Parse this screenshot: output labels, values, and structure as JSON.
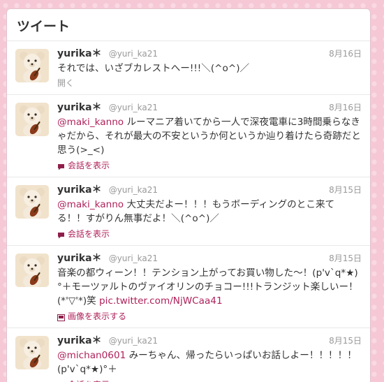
{
  "header": {
    "title": "ツイート"
  },
  "tweets": [
    {
      "name": "yurika＊",
      "handle": "@yuri_ka21",
      "date": "8月16日",
      "mention": "",
      "text": "それでは、いざブカレストへー!!!＼(^o^)／",
      "link": "",
      "action": "開く",
      "action_type": "open"
    },
    {
      "name": "yurika＊",
      "handle": "@yuri_ka21",
      "date": "8月16日",
      "mention": "@maki_kanno",
      "text": " ルーマニア着いてから一人で深夜電車に3時間乗らなきゃだから、それが最大の不安というか何というか辿り着けたら奇跡だと思う(>_<)",
      "link": "",
      "action": "会話を表示",
      "action_type": "conversation"
    },
    {
      "name": "yurika＊",
      "handle": "@yuri_ka21",
      "date": "8月15日",
      "mention": "@maki_kanno",
      "text": " 大丈夫だよー！！！もうボーディングのとこ来てる！！すがりん無事だよ！＼(^o^)／",
      "link": "",
      "action": "会話を表示",
      "action_type": "conversation"
    },
    {
      "name": "yurika＊",
      "handle": "@yuri_ka21",
      "date": "8月15日",
      "mention": "",
      "text": "音楽の都ウィーン！！テンション上がってお買い物した〜！(p'v`q*★)°＋モーツァルトのヴァイオリンのチョコー!!!トランジット楽しいー！(*'▽'*)笑 ",
      "link": "pic.twitter.com/NjWCaa41",
      "action": "画像を表示する",
      "action_type": "image"
    },
    {
      "name": "yurika＊",
      "handle": "@yuri_ka21",
      "date": "8月15日",
      "mention": "@michan0601",
      "text": " みーちゃん、帰ったらいっぱいお話しよー！！！！！(p'v`q*★)°＋",
      "link": "",
      "action": "会話を表示",
      "action_type": "conversation"
    }
  ],
  "colors": {
    "accent": "#b0215a",
    "background": "#f6c8d6",
    "muted": "#999999"
  },
  "icons": {
    "avatar": "teddy-bear-violin-icon",
    "conversation": "speech-bubble-icon",
    "image": "image-icon"
  }
}
